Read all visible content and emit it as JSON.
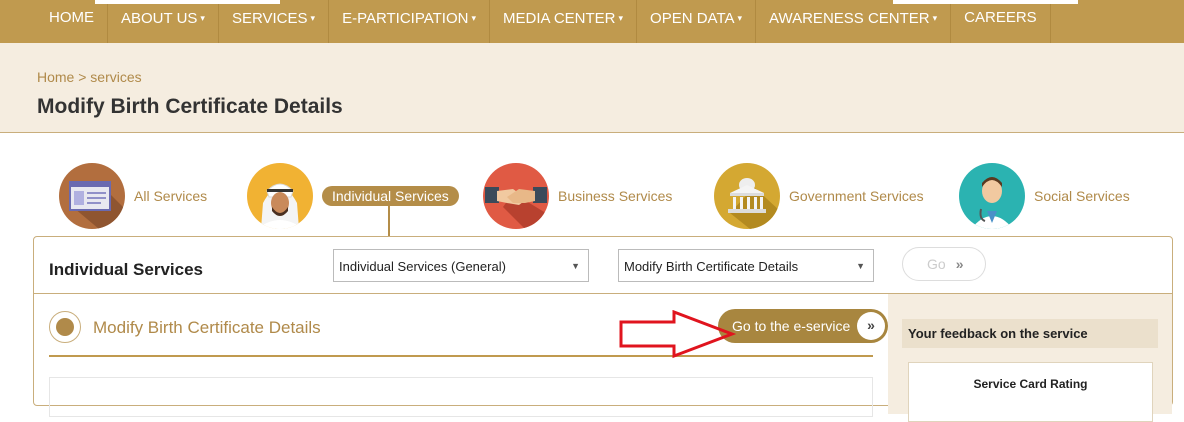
{
  "nav": {
    "items": [
      {
        "label": "HOME",
        "caret": false
      },
      {
        "label": "ABOUT US",
        "caret": true
      },
      {
        "label": "SERVICES",
        "caret": true
      },
      {
        "label": "E-PARTICIPATION",
        "caret": true
      },
      {
        "label": "MEDIA CENTER",
        "caret": true
      },
      {
        "label": "OPEN DATA",
        "caret": true
      },
      {
        "label": "AWARENESS CENTER",
        "caret": true
      },
      {
        "label": "CAREERS",
        "caret": false
      }
    ],
    "caret_glyph": "▾"
  },
  "header": {
    "breadcrumb": "Home > services",
    "title": "Modify Birth Certificate Details"
  },
  "categories": [
    {
      "label": "All Services",
      "icon": "browser-window-icon",
      "active": false
    },
    {
      "label": "Individual Services",
      "icon": "person-avatar-icon",
      "active": true
    },
    {
      "label": "Business Services",
      "icon": "handshake-icon",
      "active": false
    },
    {
      "label": "Government Services",
      "icon": "government-building-icon",
      "active": false
    },
    {
      "label": "Social Services",
      "icon": "doctor-icon",
      "active": false
    }
  ],
  "panel": {
    "title": "Individual Services",
    "category_select": "Individual Services (General)",
    "service_select": "Modify Birth Certificate Details",
    "go_label": "Go",
    "go_chevron": "»",
    "service_name": "Modify Birth Certificate Details",
    "eservice_label": "Go to the e-service",
    "eservice_chevron": "»"
  },
  "feedback": {
    "heading": "Your feedback on the service",
    "rating_label": "Service Card Rating"
  },
  "colors": {
    "brand_gold": "#c09a4f",
    "accent_red": "#e0141e"
  }
}
